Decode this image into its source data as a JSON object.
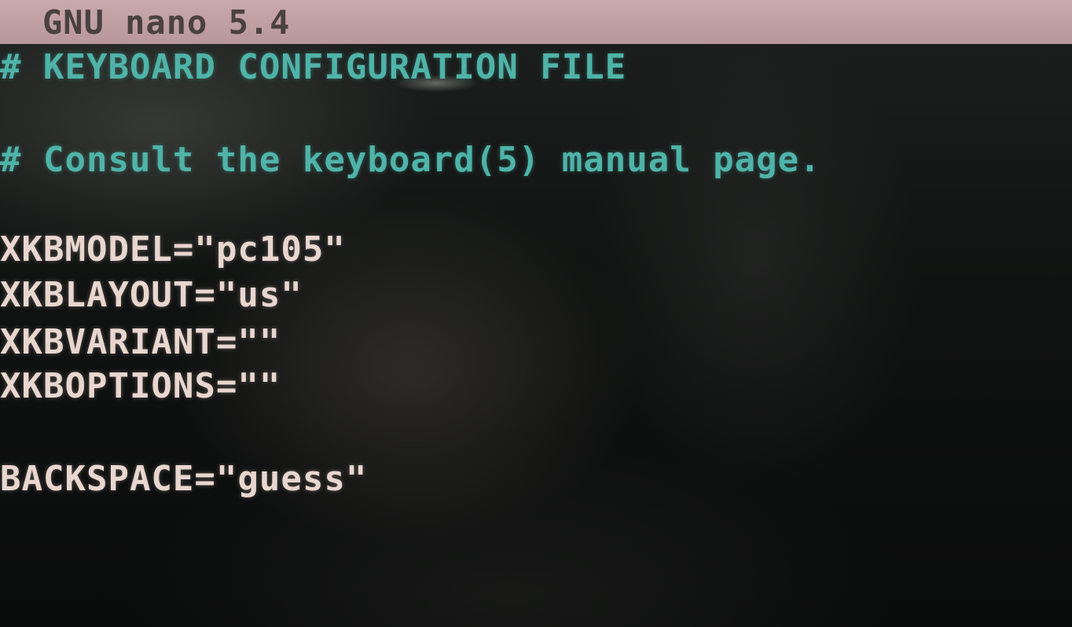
{
  "titlebar": {
    "title": "GNU nano 5.4"
  },
  "editor": {
    "lines": [
      {
        "text": "# KEYBOARD CONFIGURATION FILE",
        "kind": "comment"
      },
      {
        "text": "# Consult the keyboard(5) manual page.",
        "kind": "comment"
      },
      {
        "text": "XKBMODEL=\"pc105\"",
        "kind": "code"
      },
      {
        "text": "XKBLAYOUT=\"us\"",
        "kind": "code"
      },
      {
        "text": "XKBVARIANT=\"\"",
        "kind": "code"
      },
      {
        "text": "XKBOPTIONS=\"\"",
        "kind": "code"
      },
      {
        "text": "BACKSPACE=\"guess\"",
        "kind": "code"
      }
    ]
  },
  "colors": {
    "titlebar_bg": "#c9a9ac",
    "comment": "#4fb3a8",
    "code": "#e8d6cf",
    "background": "#0b0d0c"
  }
}
